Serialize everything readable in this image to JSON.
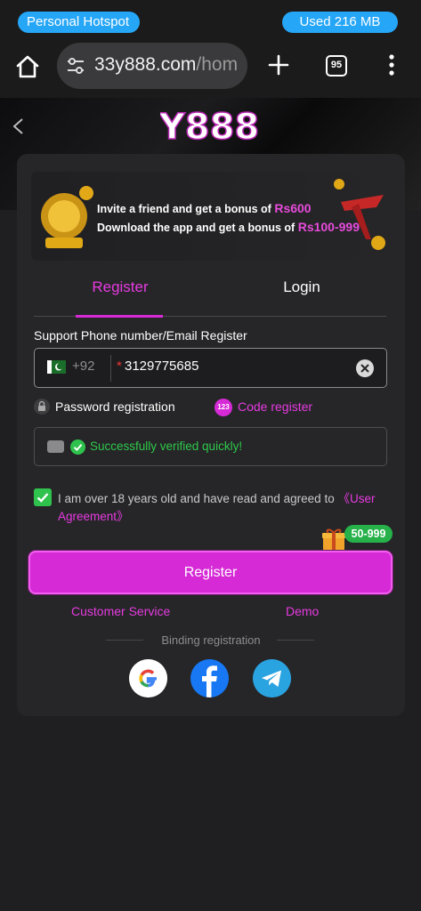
{
  "status_bar": {
    "hotspot": "Personal Hotspot",
    "usage": "Used  216 MB"
  },
  "browser": {
    "url_main": "33y888.com",
    "url_rest": "/hom",
    "tab_count": "95"
  },
  "header": {
    "logo": "Y888"
  },
  "banner": {
    "line1_text": "Invite a friend and get a bonus of ",
    "line1_amount": "Rs600",
    "line2_text": "Download the app and get a bonus of ",
    "line2_amount": "Rs100-999"
  },
  "tabs": [
    {
      "label": "Register",
      "active": true
    },
    {
      "label": "Login",
      "active": false
    }
  ],
  "form": {
    "section_label": "Support Phone number/Email Register",
    "country_code": "+92",
    "required_mark": "*",
    "phone_value": "3129775685",
    "password_registration": "Password registration",
    "code_badge": "123",
    "code_register": "Code register",
    "verify_text": "Successfully verified quickly!",
    "agree_text": "I am over 18 years old and have read and agreed to ",
    "agree_link": "《User Agreement》",
    "bonus_badge": "50-999",
    "register_button": "Register"
  },
  "links": {
    "customer_service": "Customer Service",
    "demo": "Demo"
  },
  "binding": {
    "label": "Binding registration"
  },
  "colors": {
    "accent": "#d62ad6",
    "success": "#2fc24d",
    "pill": "#26a6f6"
  }
}
